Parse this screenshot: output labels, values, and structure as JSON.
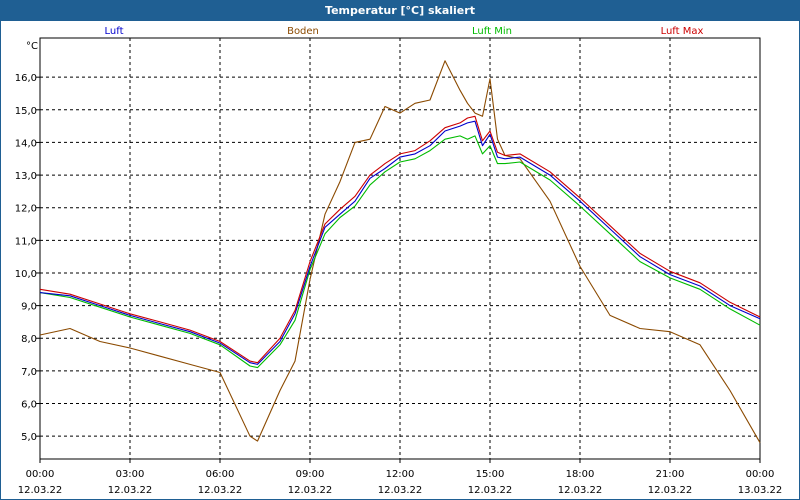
{
  "window": {
    "title": "Temperatur [°C] skaliert"
  },
  "chart_data": {
    "type": "line",
    "title": "Temperatur [°C] skaliert",
    "ylabel": "°C",
    "ylim": [
      4.3,
      17.2
    ],
    "xlim_hours": [
      0,
      24
    ],
    "grid": true,
    "legend": "top",
    "y_ticks": [
      "5,0",
      "6,0",
      "7,0",
      "8,0",
      "9,0",
      "10,0",
      "11,0",
      "12,0",
      "13,0",
      "14,0",
      "15,0",
      "16,0"
    ],
    "x_ticks": [
      {
        "time": "00:00",
        "date": "12.03.22"
      },
      {
        "time": "03:00",
        "date": "12.03.22"
      },
      {
        "time": "06:00",
        "date": "12.03.22"
      },
      {
        "time": "09:00",
        "date": "12.03.22"
      },
      {
        "time": "12:00",
        "date": "12.03.22"
      },
      {
        "time": "15:00",
        "date": "12.03.22"
      },
      {
        "time": "18:00",
        "date": "12.03.22"
      },
      {
        "time": "21:00",
        "date": "12.03.22"
      },
      {
        "time": "00:00",
        "date": "13.03.22"
      }
    ],
    "x_hours": [
      0,
      1,
      2,
      3,
      4,
      5,
      6,
      7,
      7.25,
      8,
      8.5,
      9,
      9.5,
      10,
      10.5,
      11,
      11.5,
      12,
      12.5,
      13,
      13.5,
      14,
      14.25,
      14.5,
      14.75,
      15,
      15.25,
      15.5,
      16,
      17,
      18,
      19,
      20,
      21,
      22,
      23,
      24
    ],
    "series": [
      {
        "name": "Luft",
        "color": "#0000cc",
        "values": [
          9.4,
          9.3,
          9.0,
          8.7,
          8.45,
          8.2,
          7.85,
          7.25,
          7.2,
          7.9,
          8.75,
          10.2,
          11.4,
          11.8,
          12.2,
          12.9,
          13.2,
          13.55,
          13.65,
          13.9,
          14.35,
          14.5,
          14.6,
          14.65,
          13.9,
          14.25,
          13.55,
          13.5,
          13.55,
          13.0,
          12.2,
          11.35,
          10.5,
          9.95,
          9.6,
          9.0,
          8.6
        ]
      },
      {
        "name": "Boden",
        "color": "#8b4a00",
        "values": [
          8.1,
          8.3,
          7.9,
          7.7,
          7.45,
          7.2,
          6.95,
          5.0,
          4.85,
          6.4,
          7.3,
          9.8,
          11.8,
          12.8,
          14.0,
          14.1,
          15.1,
          14.9,
          15.2,
          15.3,
          16.5,
          15.6,
          15.2,
          14.9,
          14.8,
          15.95,
          14.1,
          13.6,
          13.5,
          12.2,
          10.2,
          8.7,
          8.3,
          8.2,
          7.8,
          6.4,
          4.8
        ]
      },
      {
        "name": "Luft Min",
        "color": "#00bb00",
        "values": [
          9.4,
          9.25,
          8.95,
          8.65,
          8.4,
          8.15,
          7.8,
          7.15,
          7.1,
          7.8,
          8.55,
          10.1,
          11.2,
          11.7,
          12.05,
          12.7,
          13.1,
          13.4,
          13.5,
          13.75,
          14.1,
          14.2,
          14.1,
          14.2,
          13.65,
          13.9,
          13.35,
          13.35,
          13.4,
          12.85,
          12.05,
          11.2,
          10.35,
          9.85,
          9.5,
          8.9,
          8.4
        ]
      },
      {
        "name": "Luft Max",
        "color": "#cc0000",
        "values": [
          9.5,
          9.35,
          9.05,
          8.75,
          8.5,
          8.25,
          7.9,
          7.3,
          7.25,
          8.0,
          8.85,
          10.35,
          11.5,
          11.95,
          12.35,
          13.0,
          13.35,
          13.65,
          13.75,
          14.05,
          14.45,
          14.6,
          14.75,
          14.8,
          14.05,
          14.35,
          13.7,
          13.6,
          13.65,
          13.1,
          12.3,
          11.45,
          10.6,
          10.05,
          9.7,
          9.1,
          8.65
        ]
      }
    ]
  }
}
